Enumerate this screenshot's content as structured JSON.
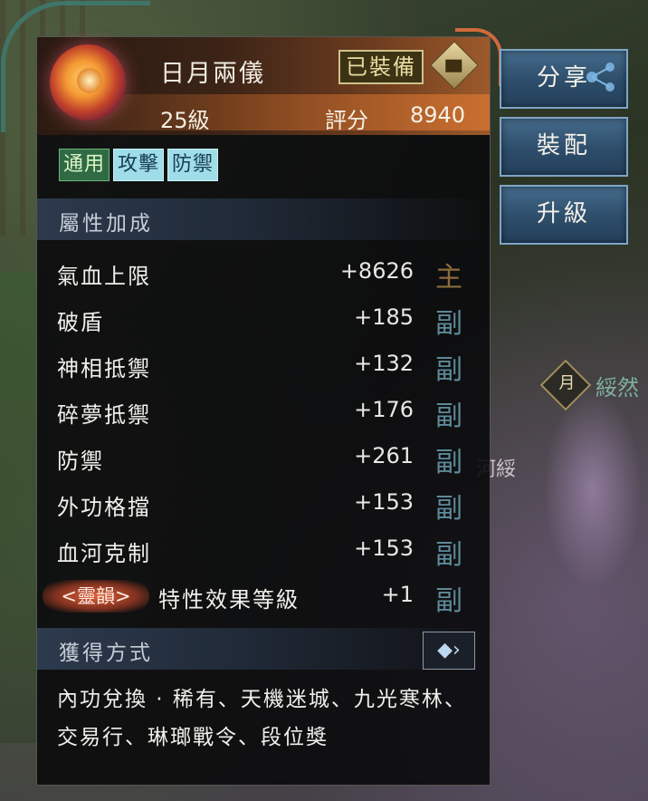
{
  "background": {
    "world_tag_icon": "月",
    "world_name": "綏然",
    "world_sub": "河綏"
  },
  "item": {
    "name": "日月兩儀",
    "equipped_label": "已裝備",
    "level": "25級",
    "score_label": "評分",
    "score_value": "8940",
    "tags": [
      "通用",
      "攻擊",
      "防禦"
    ]
  },
  "sections": {
    "attributes_title": "屬性加成",
    "source_title": "獲得方式"
  },
  "attributes": [
    {
      "name": "氣血上限",
      "value": "+8626",
      "tag": "主",
      "primary": true
    },
    {
      "name": "破盾",
      "value": "+185",
      "tag": "副",
      "primary": false
    },
    {
      "name": "神相抵禦",
      "value": "+132",
      "tag": "副",
      "primary": false
    },
    {
      "name": "碎夢抵禦",
      "value": "+176",
      "tag": "副",
      "primary": false
    },
    {
      "name": "防禦",
      "value": "+261",
      "tag": "副",
      "primary": false
    },
    {
      "name": "外功格擋",
      "value": "+153",
      "tag": "副",
      "primary": false
    },
    {
      "name": "血河克制",
      "value": "+153",
      "tag": "副",
      "primary": false
    }
  ],
  "rune": {
    "label": "<靈韻>",
    "name": "特性效果等級",
    "value": "+1",
    "tag": "副"
  },
  "source_text": "內功兌換 · 稀有、天機迷城、九光寒林、交易行、琳瑯戰令、段位獎",
  "buttons": {
    "share": "分享",
    "equip": "裝配",
    "upgrade": "升級"
  },
  "icons": {
    "item": "sun-moon-orb-icon",
    "lock": "lock-icon",
    "share": "share-icon",
    "arrow": "chevron-right-icon"
  },
  "colors": {
    "primary_tag": "#8b6c3c",
    "secondary_tag": "#5d8a99",
    "button": "#2d4d6a",
    "header_accent": "#9c5a2b"
  }
}
